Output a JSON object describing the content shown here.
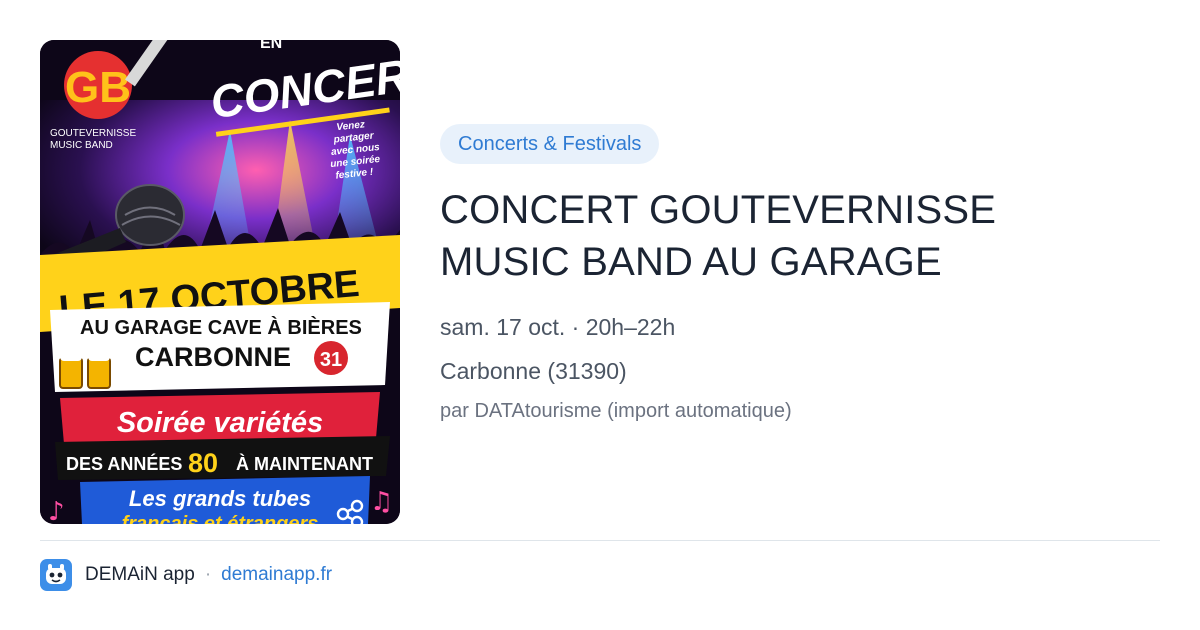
{
  "category": "Concerts & Festivals",
  "event": {
    "title_line1": "CONCERT GOUTEVERNISSE",
    "title_line2": "MUSIC BAND AU GARAGE",
    "date": "sam. 17 oct. · 20h–22h",
    "place": "Carbonne (31390)",
    "source": "par DATAtourisme (import automatique)"
  },
  "poster": {
    "logo_letters": "GB",
    "band_line1": "GOUTEVERNISSE",
    "band_line2": "MUSIC BAND",
    "headline": "CONCERT",
    "headline_prefix": "EN",
    "invite": [
      "Venez",
      "partager",
      "avec nous",
      "une soirée",
      "festive !"
    ],
    "date_banner": "LE 17 OCTOBRE",
    "venue_line": "AU GARAGE CAVE À BIÈRES",
    "town": "CARBONNE",
    "department": "31",
    "soiree": "Soirée variétés",
    "years_pre": "DES ANNÉES",
    "years_num": "80",
    "years_post": "À MAINTENANT",
    "tubes_line1": "Les grands tubes",
    "tubes_line2": "français et étrangers"
  },
  "footer": {
    "app_name": "DEMAiN app",
    "separator": "·",
    "domain": "demainapp.fr"
  },
  "colors": {
    "accent": "#2f7bd3",
    "pill_bg": "#e8f1fb",
    "title": "#1b2433",
    "muted": "#4b5563",
    "app_icon": "#3d8ee8"
  },
  "icons": {
    "share": "share-icon",
    "app": "demain-app-icon",
    "microphone": "microphone-icon",
    "beer": "beer-mugs-icon",
    "music_note": "music-note-icon"
  }
}
